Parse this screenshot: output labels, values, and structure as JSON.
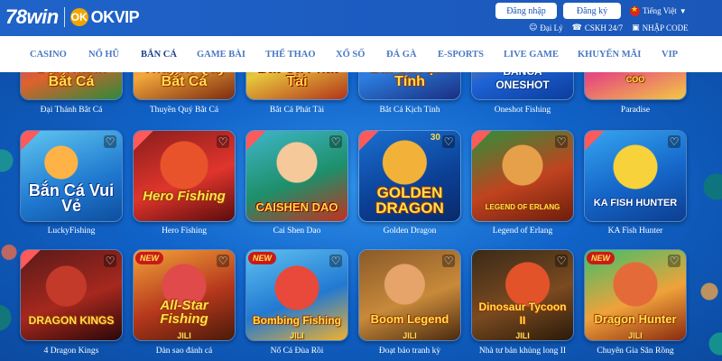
{
  "brand": {
    "logo_main": "78win",
    "logo_partner_badge": "OK",
    "logo_partner": "OKVIP"
  },
  "header": {
    "login_label": "Đăng nhập",
    "register_label": "Đăng ký",
    "language": "Tiếng Việt",
    "links": [
      {
        "label": "Đại Lý",
        "icon": "agent-icon"
      },
      {
        "label": "CSKH 24/7",
        "icon": "support-icon"
      },
      {
        "label": "NHẬP CODE",
        "icon": "code-icon"
      }
    ]
  },
  "nav": {
    "active": "BẮN CÁ",
    "items": [
      "CASINO",
      "NỔ HŨ",
      "BẮN CÁ",
      "GAME BÀI",
      "THỂ THAO",
      "XỔ SỐ",
      "ĐÁ GÀ",
      "E-SPORTS",
      "LIVE GAME",
      "KHUYẾN MÃI",
      "VIP"
    ]
  },
  "games": {
    "row1": [
      {
        "name": "Đại Thánh Bắt Cá",
        "art_text": "Đại Thánh Bắt Cá"
      },
      {
        "name": "Thuyền Quý Bắt Cá",
        "art_text": "Thuyền Quý Bắt Cá"
      },
      {
        "name": "Bắt Cá Phát Tài",
        "art_text": "Bắt Cá Phát Tài"
      },
      {
        "name": "Bắt Cá Kịch Tính",
        "art_text": "Bắt Cá Kịch Tính"
      },
      {
        "name": "Oneshot Fishing",
        "art_text": "BANCA ONESHOT"
      },
      {
        "name": "Paradise",
        "art_text": ""
      }
    ],
    "row2": [
      {
        "name": "LuckyFishing",
        "art_text": "Bắn Cá Vui Vẻ"
      },
      {
        "name": "Hero Fishing",
        "art_text": "Hero Fishing"
      },
      {
        "name": "Cai Shen Dao",
        "art_text": "CAISHEN DAO"
      },
      {
        "name": "Golden Dragon",
        "art_text": "GOLDEN DRAGON"
      },
      {
        "name": "Legend of Erlang",
        "art_text": "LEGEND OF ERLANG"
      },
      {
        "name": "KA Fish Hunter",
        "art_text": "KA FISH HUNTER"
      }
    ],
    "row3": [
      {
        "name": "4 Dragon Kings",
        "art_text": "DRAGON KINGS",
        "new": false
      },
      {
        "name": "Dàn sao đánh cá",
        "art_text": "All-Star Fishing",
        "new": true,
        "new_label": "NEW"
      },
      {
        "name": "Nổ Cá Đùa Rồi",
        "art_text": "Bombing Fishing",
        "new": true,
        "new_label": "NEW"
      },
      {
        "name": "Đoạt bảo tranh kỳ",
        "art_text": "Boom Legend",
        "new": false
      },
      {
        "name": "Nhà tư bản khủng long II",
        "art_text": "Dinosaur Tycoon II",
        "new": false
      },
      {
        "name": "Chuyên Gia Săn Rồng",
        "art_text": "Dragon Hunter",
        "new": true,
        "new_label": "NEW"
      }
    ],
    "jili_label": "JILI",
    "golden_dragon_multiplier": "30",
    "paradise_coin": "COO"
  },
  "colors": {
    "header_bg": "#1f63c9",
    "nav_text": "#4a79c2",
    "content_bg": "#1163c9",
    "caption": "#ffffff"
  }
}
